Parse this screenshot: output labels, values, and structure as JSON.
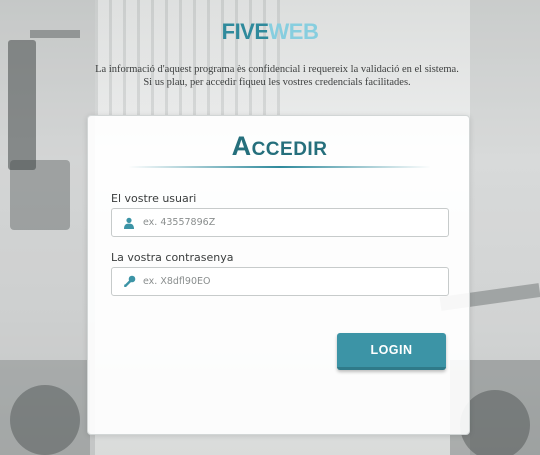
{
  "brand": {
    "part1": "FIVE",
    "part2": "WEB"
  },
  "notice": {
    "line1": "La informació d'aquest programa ès confidencial i requereix la validació en el sistema.",
    "line2": "Si us plau, per accedir fiqueu les vostres credencials facilitades."
  },
  "login_card": {
    "title": "Accedir",
    "username": {
      "label": "El vostre usuari",
      "placeholder": "ex. 43557896Z",
      "value": "",
      "icon": "user-icon"
    },
    "password": {
      "label": "La vostra contrasenya",
      "placeholder": "ex. X8dfl90EO",
      "value": "",
      "icon": "key-icon"
    },
    "submit_label": "LOGIN"
  },
  "colors": {
    "accent": "#3c94a6",
    "title": "#256f7c",
    "brand_dark": "#2f8a9c",
    "brand_light": "#87cedf"
  }
}
